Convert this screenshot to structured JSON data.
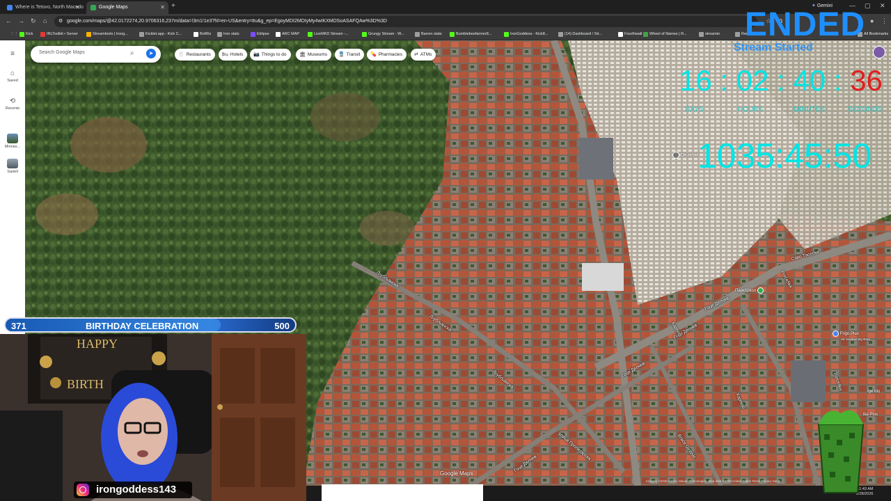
{
  "browser": {
    "tabs": [
      {
        "title": "Where is Tetovo, North Macedo",
        "active": false
      },
      {
        "title": "Google Maps",
        "active": true
      }
    ],
    "gemini_label": "Gemini",
    "url": "google.com/maps/@42.0172274,20.9706316,237m/data=!3m1!1e3?hl=en-US&entry=ttu&g_ep=EgoyMDI2MDIyMy4wIKXMDSoASAFQAw%3D%3D",
    "bookmarks": [
      {
        "label": "Kick",
        "color": "#53fc18"
      },
      {
        "label": "IRLToolkit • Server",
        "color": "#e53935"
      },
      {
        "label": "Streamloots | Irong...",
        "color": "#ffb300"
      },
      {
        "label": "Kicklet.app - Kick C...",
        "color": "#9e9e9e"
      },
      {
        "label": "BotRix",
        "color": "#ffffff"
      },
      {
        "label": "Iron stats",
        "color": "#9e9e9e"
      },
      {
        "label": "Eklipse",
        "color": "#7c4dff"
      },
      {
        "label": "ARC MAP",
        "color": "#ffffff"
      },
      {
        "label": "LiveMKD Stream -...",
        "color": "#53fc18"
      },
      {
        "label": "Grungy Stream - W...",
        "color": "#53fc18"
      },
      {
        "label": "Barren stats",
        "color": "#9e9e9e"
      },
      {
        "label": "Bumblebeefarmer8...",
        "color": "#53fc18"
      },
      {
        "label": "IronGoddess - Kick8...",
        "color": "#53fc18"
      },
      {
        "label": "(14) Dashboard / Str...",
        "color": "#9e9e9e"
      },
      {
        "label": "Fourthwall",
        "color": "#ffffff"
      },
      {
        "label": "Wheel of Names | R...",
        "color": "#43a047"
      },
      {
        "label": "streamin",
        "color": "#9e9e9e"
      },
      {
        "label": "Rem",
        "color": "#9e9e9e"
      },
      {
        "label": "All Bookmarks",
        "color": "#9e9e9e"
      }
    ]
  },
  "maps": {
    "search_placeholder": "Search Google Maps",
    "rail": [
      {
        "label": "",
        "icon": "menu-icon"
      },
      {
        "label": "Saved",
        "icon": "bookmark-icon"
      },
      {
        "label": "Recents",
        "icon": "history-icon"
      },
      {
        "label": "Minnes...",
        "icon": "place-thumbnail"
      },
      {
        "label": "Sartell",
        "icon": "place-thumbnail"
      }
    ],
    "chips": [
      {
        "label": "Restaurants",
        "icon": "🍴"
      },
      {
        "label": "Hotels",
        "icon": "🛏"
      },
      {
        "label": "Things to do",
        "icon": "📷"
      },
      {
        "label": "Museums",
        "icon": "🏛"
      },
      {
        "label": "Transit",
        "icon": "🚆"
      },
      {
        "label": "Pharmacies",
        "icon": "💊"
      },
      {
        "label": "ATMs",
        "icon": "⇄"
      }
    ],
    "road_labels": [
      {
        "text": "Љубљанска",
        "key": "r1"
      },
      {
        "text": "Љубљанска",
        "key": "r2"
      },
      {
        "text": "Љубљанска",
        "key": "r3"
      },
      {
        "text": "Гоце Делчев",
        "key": "r4"
      },
      {
        "text": "Гоце Делчев",
        "key": "r5"
      },
      {
        "text": "Гоце Делчев",
        "key": "r6"
      },
      {
        "text": "Гоце Делчев",
        "key": "r7"
      },
      {
        "text": "Саво Тасески",
        "key": "r8"
      },
      {
        "text": "Карпош",
        "key": "r9"
      },
      {
        "text": "Карпош",
        "key": "r10"
      },
      {
        "text": "Porceška",
        "key": "r11"
      },
      {
        "text": "Porceška",
        "key": "r12"
      },
      {
        "text": "улица Пролетарска",
        "key": "r13"
      },
      {
        "text": "Braće Ginoski",
        "key": "r14"
      }
    ],
    "poi": [
      {
        "text": "Church of",
        "key": "p1"
      },
      {
        "text": "Парк/Школ",
        "key": "p2"
      },
      {
        "text": "Frigo Plus",
        "key": "p3"
      },
      {
        "text": "Air conditioning store",
        "key": "p4"
      },
      {
        "text": "Ige Mo",
        "key": "p5"
      },
      {
        "text": "ika Plus",
        "key": "p6"
      }
    ],
    "logo": "Google Maps",
    "attribution": "Imagery ©2026 Airbus, Maxar Technologies, Map data ©2026   United States   Terms   Privacy   Send"
  },
  "overlay": {
    "ended": "ENDED",
    "stream_started": "Stream Started",
    "timer": {
      "days": "16",
      "hours": "02",
      "minutes": "40",
      "seconds": "36",
      "sep": ":"
    },
    "timer_labels": {
      "days": "DAYS",
      "hours": "HOURS",
      "minutes": "MINUTES",
      "seconds": "SECONDS"
    },
    "big_timer": "1035:45:50",
    "goal": {
      "current": "371",
      "title": "BIRTHDAY CELEBRATION",
      "target": "500",
      "progress": 0.742
    },
    "instagram_handle": "irongoddess143",
    "tray_time": "11:43 AM",
    "tray_date": "2/28/2026"
  }
}
